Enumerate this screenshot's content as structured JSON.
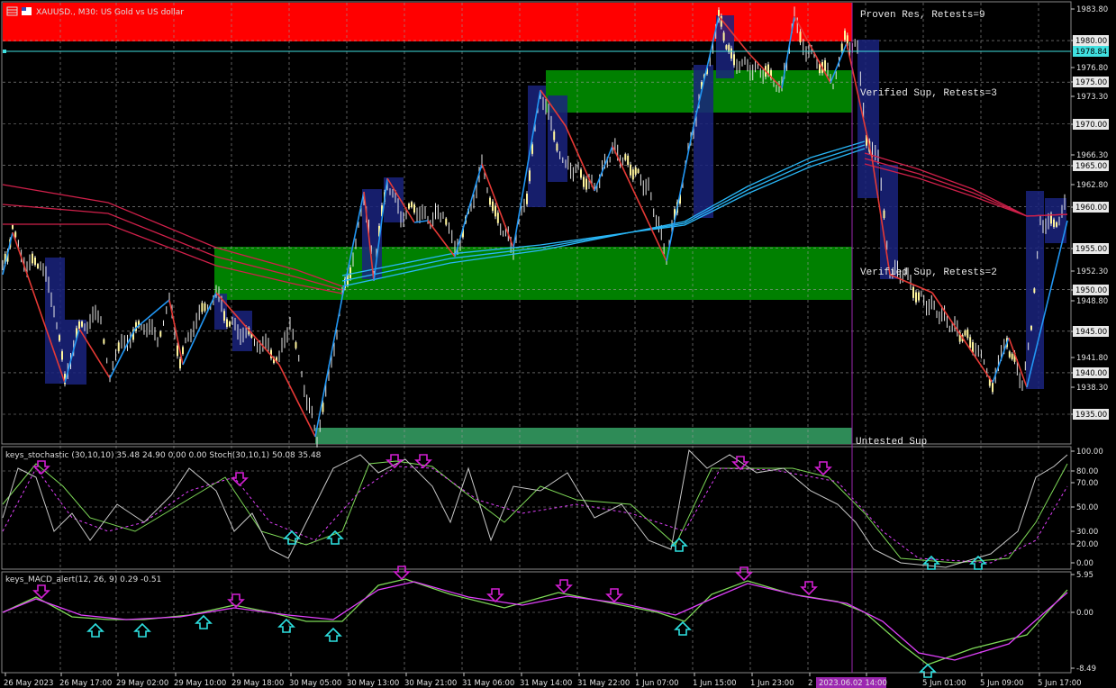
{
  "window": {
    "title": "XAUUSD., M30: US Gold vs US dollar"
  },
  "zones": {
    "proven_res": "Proven Res, Retests=9",
    "verified_sup_1": "Verified Sup, Retests=3",
    "verified_sup_2": "Verified Sup, Retests=2",
    "untested_sup": "Untested Sup"
  },
  "indicators": {
    "stoch_label": "keys_stochastic (30,10,10) 35.48 24.90 0.00 0.00 Stoch(30,10,1) 50.08 35.48",
    "macd_label": "keys_MACD_alert(12, 26, 9) 0.29 -0.51"
  },
  "price_axis": {
    "ticks": [
      "1983.80",
      "1980.00",
      "1976.80",
      "1975.00",
      "1973.30",
      "1970.00",
      "1966.30",
      "1965.00",
      "1962.80",
      "1960.00",
      "1955.00",
      "1952.30",
      "1950.00",
      "1948.80",
      "1945.00",
      "1941.80",
      "1940.00",
      "1938.30",
      "1935.00"
    ],
    "boxed": [
      "1980.00",
      "1975.00",
      "1970.00",
      "1965.00",
      "1960.00",
      "1955.00",
      "1950.00",
      "1945.00",
      "1940.00",
      "1935.00"
    ],
    "current": "1978.84"
  },
  "stoch_axis": {
    "ticks": [
      "100.00",
      "80.00",
      "70.00",
      "50.00",
      "30.00",
      "20.00",
      "0.00"
    ]
  },
  "macd_axis": {
    "ticks": [
      "5.95",
      "0.00",
      "-8.49"
    ]
  },
  "time_axis": {
    "labels": [
      "26 May 2023",
      "26 May 17:00",
      "29 May 02:00",
      "29 May 10:00",
      "29 May 18:00",
      "30 May 05:00",
      "30 May 13:00",
      "30 May 21:00",
      "31 May 06:00",
      "31 May 14:00",
      "31 May 22:00",
      "1 Jun 07:00",
      "1 Jun 15:00",
      "1 Jun 23:00",
      "2",
      "16:00",
      "5 Jun 01:00",
      "5 Jun 09:00",
      "5 Jun 17:00"
    ],
    "cursor_label": "2023.06.02 14:00"
  },
  "colors": {
    "resistance": "#ff0000",
    "support": "#008000",
    "untested": "#2e8b57",
    "ma_red": "#d0204a",
    "ma_blue": "#29b6f6",
    "zigzag_up": "#2196f3",
    "zigzag_down": "#e53935",
    "cursor": "#9c27b0",
    "arrow_down": "#d21fd2",
    "arrow_up": "#2de0e0"
  }
}
